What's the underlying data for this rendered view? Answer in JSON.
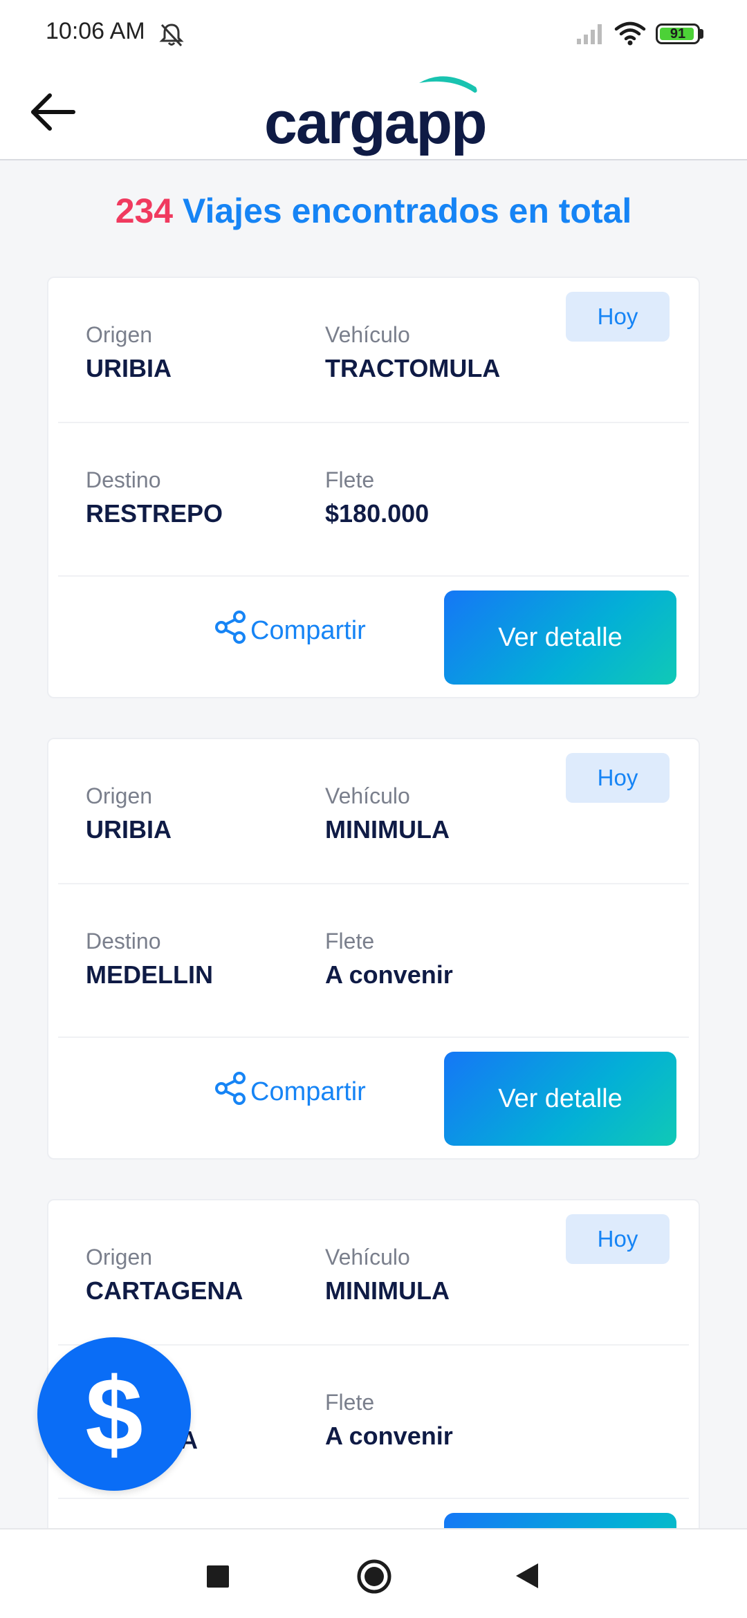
{
  "status_bar": {
    "time": "10:06 AM",
    "battery": "91"
  },
  "header": {
    "logo_text": "cargapp"
  },
  "summary": {
    "count": "234",
    "text": "Viajes encontrados en total"
  },
  "labels": {
    "origin": "Origen",
    "vehicle": "Vehículo",
    "destination": "Destino",
    "freight": "Flete",
    "share": "Compartir",
    "details": "Ver detalle"
  },
  "trips": [
    {
      "badge": "Hoy",
      "origin": "URIBIA",
      "vehicle": "TRACTOMULA",
      "destination": "RESTREPO",
      "freight": "$180.000"
    },
    {
      "badge": "Hoy",
      "origin": "URIBIA",
      "vehicle": "MINIMULA",
      "destination": "MEDELLIN",
      "freight": "A convenir"
    },
    {
      "badge": "Hoy",
      "origin": "CARTAGENA",
      "vehicle": "MINIMULA",
      "destination": "",
      "destination_partial": "A",
      "freight": "A convenir"
    }
  ],
  "fab": {
    "symbol": "$"
  },
  "icons": {
    "back": "arrow-left-icon",
    "share": "share-icon",
    "mute": "bell-off-icon",
    "signal": "signal-icon",
    "wifi": "wifi-icon",
    "battery": "battery-icon"
  },
  "colors": {
    "accent_blue": "#1684f5",
    "count_pink": "#f03a5f",
    "navy_text": "#0f1b45",
    "badge_bg": "#deebfc",
    "fab_blue": "#0a6df6",
    "button_gradient_start": "#1577f6",
    "button_gradient_end": "#10c9b6"
  }
}
